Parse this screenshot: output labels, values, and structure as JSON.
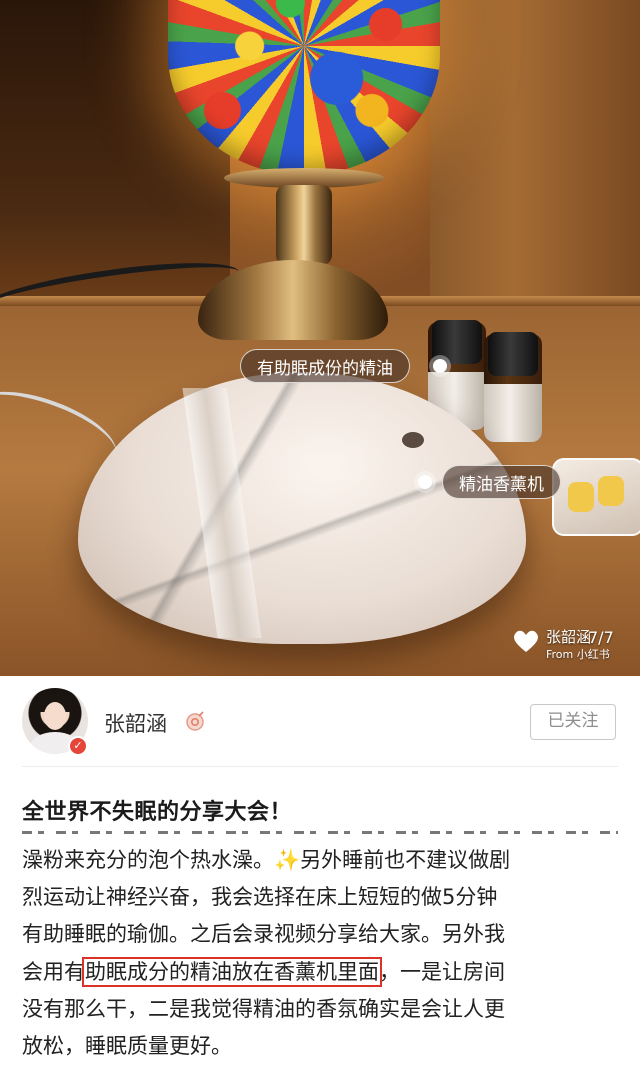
{
  "photo": {
    "tags": [
      {
        "label": "有助眠成份的精油"
      },
      {
        "label": "精油香薰机"
      }
    ],
    "watermark": {
      "name": "张韶涵",
      "from": "From 小红书"
    },
    "counter": "7/7"
  },
  "author": {
    "name": "张韶涵",
    "follow_label": "已关注"
  },
  "post": {
    "title": "全世界不失眠的分享大会！",
    "lines": [
      {
        "pre": "澡粉来充分的泡个热水澡。",
        "icon": "✨",
        "post": "另外睡前也不建议做剧"
      },
      {
        "text": "烈运动让神经兴奋，我会选择在床上短短的做5分钟"
      },
      {
        "text": "有助睡眠的瑜伽。之后会录视频分享给大家。另外我"
      },
      {
        "pre": "会用有",
        "highlight": "助眠成分的精油放在香薰机里面",
        "post": "，一是让房间"
      },
      {
        "text": "没有那么干，二是我觉得精油的香氛确实是会让人更"
      },
      {
        "text": "放松，睡眠质量更好。"
      }
    ]
  },
  "colors": {
    "highlight_box": "#d9332a",
    "follow_border": "#c8c8c8",
    "verify_badge": "#e6463a"
  }
}
